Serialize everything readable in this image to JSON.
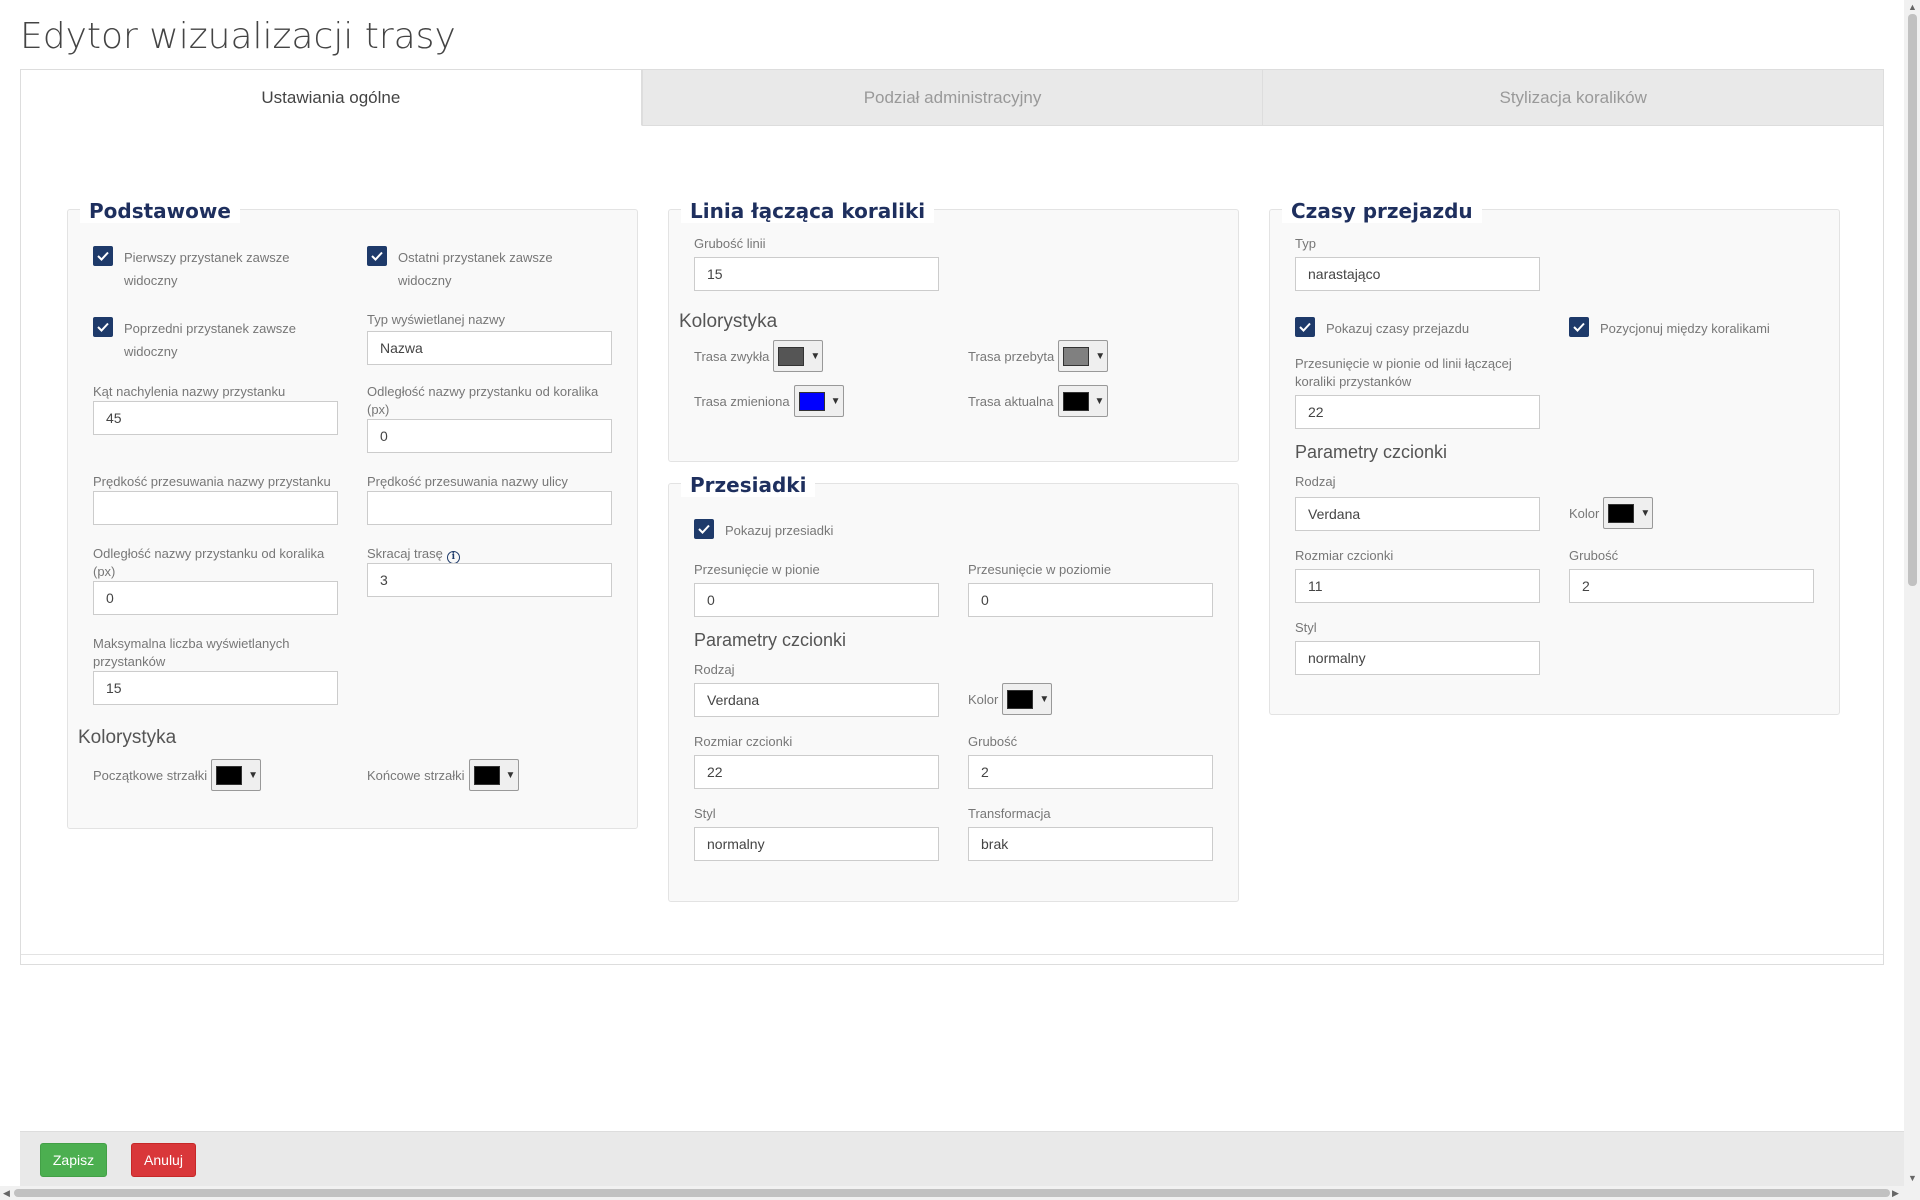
{
  "page_title": "Edytor wizualizacji trasy",
  "tabs": [
    "Ustawiania ogólne",
    "Podział administracyjny",
    "Stylizacja koralików"
  ],
  "basic": {
    "legend": "Podstawowe",
    "cb_first": "Pierwszy przystanek zawsze widoczny",
    "cb_last": "Ostatni przystanek zawsze widoczny",
    "cb_prev": "Poprzedni przystanek zawsze widoczny",
    "name_type_label": "Typ wyświetlanej nazwy",
    "name_type_value": "Nazwa",
    "angle_label": "Kąt nachylenia nazwy przystanku",
    "angle_value": "45",
    "distance_label": "Odległość nazwy przystanku od koralika (px)",
    "distance_value": "0",
    "stop_speed_label": "Prędkość przesuwania nazwy przystanku",
    "stop_speed_value": "",
    "street_speed_label": "Prędkość przesuwania nazwy ulicy",
    "street_speed_value": "",
    "distance2_label": "Odległość nazwy przystanku od koralika (px)",
    "distance2_value": "0",
    "shorten_label": "Skracaj trasę",
    "shorten_value": "3",
    "max_label": "Maksymalna liczba wyświetlanych przystanków",
    "max_value": "15",
    "colors_heading": "Kolorystyka",
    "start_arrows_label": "Początkowe strzałki",
    "end_arrows_label": "Końcowe strzałki"
  },
  "line": {
    "legend": "Linia łącząca koraliki",
    "width_label": "Grubość linii",
    "width_value": "15",
    "colors_heading": "Kolorystyka",
    "normal_label": "Trasa zwykła",
    "traveled_label": "Trasa przebyta",
    "changed_label": "Trasa zmieniona",
    "current_label": "Trasa aktualna"
  },
  "transfers": {
    "legend": "Przesiadki",
    "cb_show": "Pokazuj przesiadki",
    "voffset_label": "Przesunięcie w pionie",
    "voffset_value": "0",
    "hoffset_label": "Przesunięcie w poziomie",
    "hoffset_value": "0",
    "font_heading": "Parametry czcionki",
    "font_type_label": "Rodzaj",
    "font_type_value": "Verdana",
    "color_label": "Kolor",
    "font_size_label": "Rozmiar czcionki",
    "font_size_value": "22",
    "weight_label": "Grubość",
    "weight_value": "2",
    "style_label": "Styl",
    "style_value": "normalny",
    "transform_label": "Transformacja",
    "transform_value": "brak"
  },
  "times": {
    "legend": "Czasy przejazdu",
    "type_label": "Typ",
    "type_value": "narastająco",
    "cb_show": "Pokazuj czasy przejazdu",
    "cb_position": "Pozycjonuj między koralikami",
    "voffset_label": "Przesunięcie w pionie od linii łączącej koraliki przystanków",
    "voffset_value": "22",
    "font_heading": "Parametry czcionki",
    "font_type_label": "Rodzaj",
    "font_type_value": "Verdana",
    "color_label": "Kolor",
    "font_size_label": "Rozmiar czcionki",
    "font_size_value": "11",
    "weight_label": "Grubość",
    "weight_value": "2",
    "style_label": "Styl",
    "style_value": "normalny"
  },
  "colors": {
    "start_arrows": "#000000",
    "end_arrows": "#000000",
    "route_normal": "#555555",
    "route_traveled": "#808080",
    "route_changed": "#0000ff",
    "route_current": "#000000",
    "transfer_font": "#000000",
    "times_font": "#000000",
    "accent": "#1e2f5e"
  },
  "footer": {
    "save": "Zapisz",
    "cancel": "Anuluj"
  }
}
